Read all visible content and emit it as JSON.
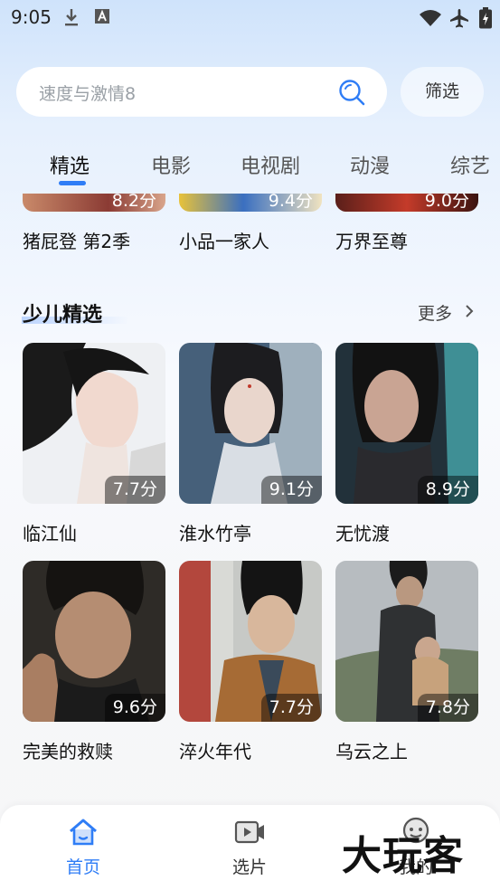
{
  "status_bar": {
    "time": "9:05",
    "icons": [
      "download-icon",
      "text-a-icon",
      "wifi-icon",
      "airplane-icon",
      "battery-charging-icon"
    ]
  },
  "search": {
    "placeholder": "速度与激情8",
    "filter_label": "筛选"
  },
  "tabs": [
    {
      "label": "精选",
      "active": true
    },
    {
      "label": "电影",
      "active": false
    },
    {
      "label": "电视剧",
      "active": false
    },
    {
      "label": "动漫",
      "active": false
    },
    {
      "label": "综艺",
      "active": false
    }
  ],
  "top_row": [
    {
      "title": "猪屁登 第2季",
      "score": "8.2分"
    },
    {
      "title": "小品一家人",
      "score": "9.4分"
    },
    {
      "title": "万界至尊",
      "score": "9.0分"
    }
  ],
  "section": {
    "title": "少儿精选",
    "more_label": "更多",
    "items": [
      {
        "title": "临江仙",
        "score": "7.7分"
      },
      {
        "title": "淮水竹亭",
        "score": "9.1分"
      },
      {
        "title": "无忧渡",
        "score": "8.9分"
      },
      {
        "title": "完美的救赎",
        "score": "9.6分"
      },
      {
        "title": "淬火年代",
        "score": "7.7分"
      },
      {
        "title": "乌云之上",
        "score": "7.8分"
      }
    ]
  },
  "bottom_nav": [
    {
      "label": "首页",
      "icon": "home-icon",
      "active": true
    },
    {
      "label": "选片",
      "icon": "video-icon",
      "active": false
    },
    {
      "label": "我的",
      "icon": "profile-icon",
      "active": false
    }
  ],
  "watermark": "大玩客",
  "colors": {
    "accent": "#2f7df6"
  }
}
